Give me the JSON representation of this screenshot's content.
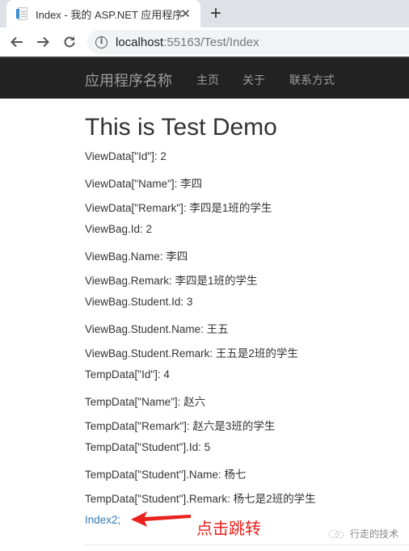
{
  "browser": {
    "tab": {
      "title": "Index - 我的 ASP.NET 应用程序",
      "favicon": "document-icon",
      "close_glyph": "✕"
    },
    "new_tab_glyph": "+",
    "url": {
      "host": "localhost",
      "rest": ":55163/Test/Index"
    }
  },
  "navbar": {
    "brand": "应用程序名称",
    "links": [
      "主页",
      "关于",
      "联系方式"
    ]
  },
  "page": {
    "heading": "This is Test Demo",
    "lines": [
      "ViewData[\"Id\"]: 2",
      "ViewData[\"Name\"]: 李四",
      "ViewData[\"Remark\"]: 李四是1班的学生",
      "ViewBag.Id: 2",
      "ViewBag.Name: 李四",
      "ViewBag.Remark: 李四是1班的学生",
      "ViewBag.Student.Id: 3",
      "ViewBag.Student.Name: 王五",
      "ViewBag.Student.Remark: 王五是2班的学生",
      "TempData[\"Id\"]: 4",
      "TempData[\"Name\"]: 赵六",
      "TempData[\"Remark\"]: 赵六是3班的学生",
      "TempData[\"Student\"].Id: 5",
      "TempData[\"Student\"].Name: 杨七",
      "TempData[\"Student\"].Remark: 杨七是2班的学生"
    ],
    "link": "Index2;",
    "annotation": "点击跳转",
    "annotation_color": "#e8211c",
    "link_color": "#337ab7"
  },
  "watermark": {
    "text": "行走的技术",
    "icon": "wechat-icon"
  }
}
